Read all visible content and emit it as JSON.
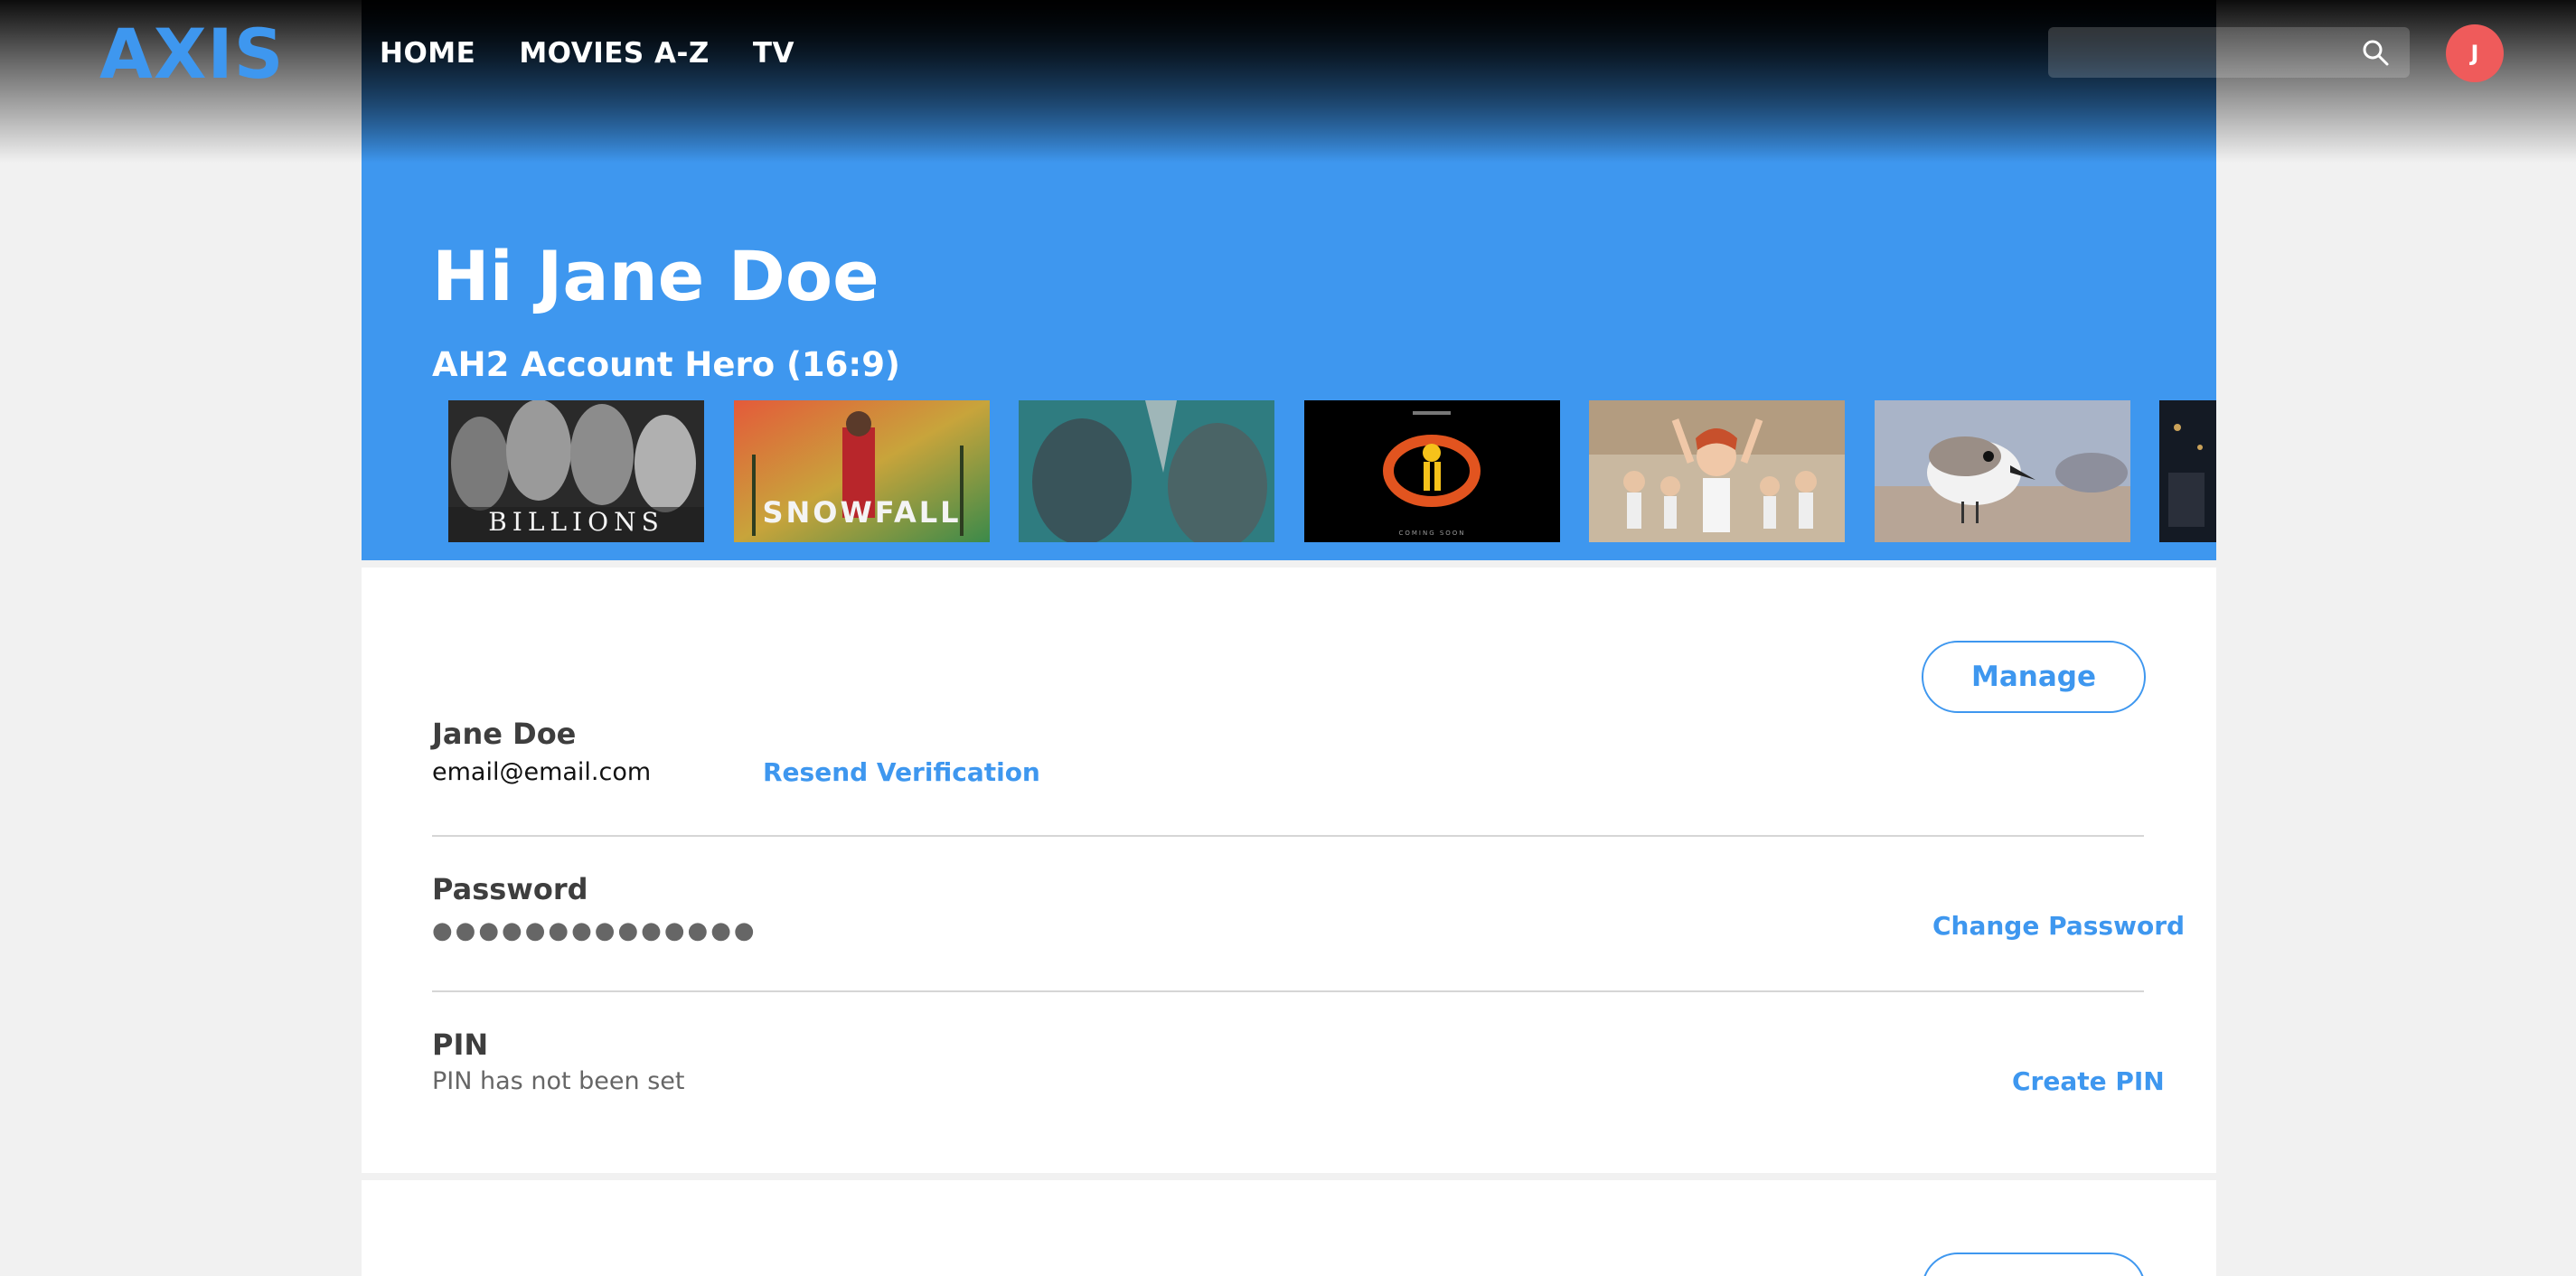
{
  "header": {
    "logo": "AXIS",
    "nav": [
      "HOME",
      "MOVIES A-Z",
      "TV"
    ],
    "search": {
      "placeholder": "",
      "value": ""
    },
    "avatar_initial": "J"
  },
  "hero": {
    "greeting": "Hi Jane Doe",
    "rail_title": "AH2 Account Hero (16:9)",
    "thumbnails": [
      {
        "name": "billions",
        "text": "BILLIONS"
      },
      {
        "name": "snowfall",
        "text": "SNOWFALL"
      },
      {
        "name": "vikings",
        "text": ""
      },
      {
        "name": "incredibles-2",
        "text": "COMING SOON"
      },
      {
        "name": "ballet-dancer",
        "text": ""
      },
      {
        "name": "piper-bird",
        "text": ""
      },
      {
        "name": "dark-scene",
        "text": ""
      }
    ]
  },
  "account": {
    "manage_label": "Manage",
    "name": "Jane Doe",
    "email": "email@email.com",
    "resend_label": "Resend Verification",
    "password_label": "Password",
    "password_mask": "●●●●●●●●●●●●●●",
    "change_password_label": "Change Password",
    "pin_label": "PIN",
    "pin_status": "PIN has not been set",
    "create_pin_label": "Create PIN"
  },
  "colors": {
    "accent": "#3e97ef",
    "avatar": "#ef5b5b",
    "background": "#f1f1f1"
  }
}
